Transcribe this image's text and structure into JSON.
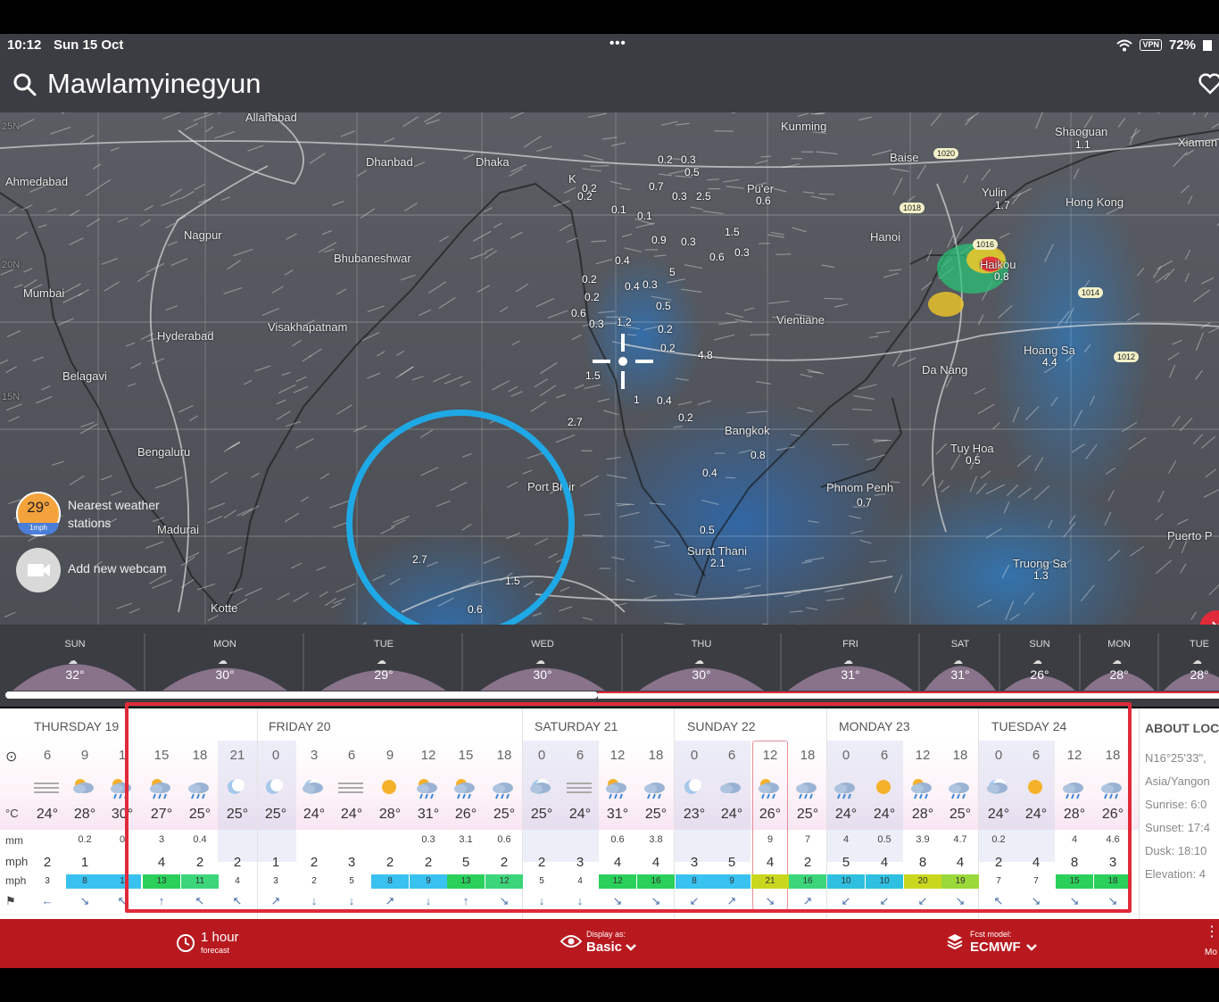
{
  "status_bar": {
    "time": "10:12",
    "date": "Sun 15 Oct",
    "dots": "•••",
    "vpn": "VPN",
    "battery": "72%"
  },
  "header": {
    "location": "Mawlamyinegyun"
  },
  "map": {
    "labels": [
      "Allahabad",
      "Dhanbad",
      "Dhaka",
      "Ahmedabad",
      "Nagpur",
      "Bhubaneshwar",
      "Mumbai",
      "Hyderabad",
      "Visakhapatnam",
      "Belagavi",
      "Bengaluru",
      "Madurai",
      "Kotte",
      "Kunming",
      "Baise",
      "Shaoguan",
      "Xiamen",
      "Pu'er",
      "Hanoi",
      "Yulin",
      "Hong Kong",
      "Haikou",
      "Vientiane",
      "Da Nang",
      "Hoang Sa",
      "Bangkok",
      "Tuy Hoa",
      "Phnom Penh",
      "Surat Thani",
      "Truong Sa",
      "Puerto P",
      "Port Blair",
      "K"
    ],
    "rain_values": [
      "0.2",
      "0.2",
      "0.3",
      "0.5",
      "0.7",
      "0.3",
      "2.5",
      "0.6",
      "0.2",
      "0.1",
      "0.1",
      "0.9",
      "0.3",
      "1.5",
      "0.6",
      "0.3",
      "0.4",
      "0.2",
      "0.3",
      "0.2",
      "5",
      "0.4",
      "0.6",
      "0.5",
      "1.2",
      "0.3",
      "0.2",
      "0.2",
      "4.8",
      "1.5",
      "1",
      "0.4",
      "0.2",
      "2.7",
      "0.4",
      "0.5",
      "2.1",
      "2.7",
      "1.5",
      "0.6",
      "0.8",
      "1.7",
      "1.1",
      "0.8",
      "4.4",
      "0.5",
      "1.3",
      "0.7"
    ],
    "pressure": [
      "1020",
      "1018",
      "1016",
      "1014",
      "1012"
    ],
    "lat_labels": [
      "25N",
      "20N",
      "15N"
    ],
    "nearest": {
      "temp": "29°",
      "wind": "1mph",
      "text": "Nearest weather stations"
    },
    "webcam": "Add new webcam",
    "close": "×"
  },
  "week": [
    {
      "day": "SUN",
      "temp": "32°"
    },
    {
      "day": "MON",
      "temp": "30°"
    },
    {
      "day": "TUE",
      "temp": "29°"
    },
    {
      "day": "WED",
      "temp": "30°"
    },
    {
      "day": "THU",
      "temp": "30°"
    },
    {
      "day": "FRI",
      "temp": "31°"
    },
    {
      "day": "SAT",
      "temp": "31°"
    },
    {
      "day": "SUN",
      "temp": "26°"
    },
    {
      "day": "MON",
      "temp": "28°"
    },
    {
      "day": "TUE",
      "temp": "28°"
    }
  ],
  "table": {
    "days": [
      "THURSDAY 19",
      "FRIDAY 20",
      "SATURDAY 21",
      "SUNDAY 22",
      "MONDAY 23",
      "TUESDAY 24"
    ],
    "row_labels": {
      "temp": "°C",
      "rain": "mm",
      "wind": "mph",
      "gust": "mph"
    },
    "hours": [
      "6",
      "9",
      "1",
      "15",
      "18",
      "21",
      "0",
      "3",
      "6",
      "9",
      "12",
      "15",
      "18",
      "0",
      "6",
      "12",
      "18",
      "0",
      "6",
      "12",
      "18",
      "0",
      "6",
      "12",
      "18",
      "0",
      "6",
      "12",
      "18"
    ],
    "icons": [
      "fog",
      "cloud-sun",
      "rain",
      "rain",
      "cloud-rain",
      "moon",
      "moon",
      "moon-cloud",
      "fog",
      "sun",
      "rain",
      "rain",
      "cloud-rain",
      "moon-cloud",
      "fog",
      "rain",
      "cloud-rain",
      "moon",
      "cloud",
      "rain",
      "cloud-rain",
      "cloud-rain",
      "sun",
      "rain",
      "cloud-rain",
      "moon-cloud",
      "sun",
      "cloud-rain",
      "cloud-rain"
    ],
    "temps": [
      "24°",
      "28°",
      "30°",
      "27°",
      "25°",
      "25°",
      "25°",
      "24°",
      "24°",
      "28°",
      "31°",
      "26°",
      "25°",
      "25°",
      "24°",
      "31°",
      "25°",
      "23°",
      "24°",
      "26°",
      "25°",
      "24°",
      "24°",
      "28°",
      "25°",
      "24°",
      "24°",
      "28°",
      "26°"
    ],
    "rain": [
      "",
      "0.2",
      "0",
      "3",
      "0.4",
      "",
      "",
      "",
      "",
      "",
      "0.3",
      "3.1",
      "0.6",
      "",
      "",
      "0.6",
      "3.8",
      "",
      "",
      "9",
      "7",
      "4",
      "0.5",
      "3.9",
      "4.7",
      "0.2",
      "",
      "4",
      "4.6"
    ],
    "wind": [
      "2",
      "1",
      "",
      "4",
      "2",
      "2",
      "1",
      "2",
      "3",
      "2",
      "2",
      "5",
      "2",
      "2",
      "3",
      "4",
      "4",
      "3",
      "5",
      "4",
      "2",
      "5",
      "4",
      "8",
      "4",
      "2",
      "4",
      "8",
      "3"
    ],
    "gust": [
      "3",
      "8",
      "1",
      "13",
      "11",
      "4",
      "3",
      "2",
      "5",
      "8",
      "9",
      "13",
      "12",
      "5",
      "4",
      "12",
      "16",
      "8",
      "9",
      "21",
      "16",
      "10",
      "10",
      "20",
      "19",
      "7",
      "7",
      "15",
      "18"
    ],
    "gust_colors": [
      "",
      "#39c1ef",
      "#39c1ef",
      "#2ad05a",
      "#3cd57a",
      "",
      "",
      "",
      "",
      "#39c1ef",
      "#39c1ef",
      "#2ad05a",
      "#3cd57a",
      "",
      "",
      "#2ad05a",
      "#2ad05a",
      "#39c1ef",
      "#39c1ef",
      "#c9d81e",
      "#3cd57a",
      "#2fbfe0",
      "#2fbfe0",
      "#c9d81e",
      "#9bd83a",
      "",
      "",
      "#2ad05a",
      "#2ad05a"
    ],
    "arrows": [
      "←",
      "↘",
      "↖",
      "↑",
      "↖",
      "↖",
      "↗",
      "↓",
      "↓",
      "↗",
      "↓",
      "↑",
      "↘",
      "↓",
      "↓",
      "↘",
      "↘",
      "↙",
      "↗",
      "↘",
      "↗",
      "↙",
      "↙",
      "↙",
      "↘",
      "↖",
      "↘",
      "↘",
      "↘"
    ]
  },
  "about": {
    "title": "ABOUT LOC",
    "coords": "N16°25'33\",",
    "timezone": "Asia/Yangon",
    "sunrise": "Sunrise: 6:0",
    "sunset": "Sunset: 17:4",
    "dusk": "Dusk: 18:10",
    "elevation": "Elevation: 4"
  },
  "bottom_bar": {
    "hour_main": "1 hour",
    "hour_sub": "forecast",
    "display_small": "Display as:",
    "display_value": "Basic",
    "model_small": "Fcst model:",
    "model_value": "ECMWF",
    "more": "Mo"
  },
  "colors": {
    "accent_red": "#e02a3a",
    "bar_red": "#b8191f",
    "highlight_blue": "#1fa8e6"
  }
}
